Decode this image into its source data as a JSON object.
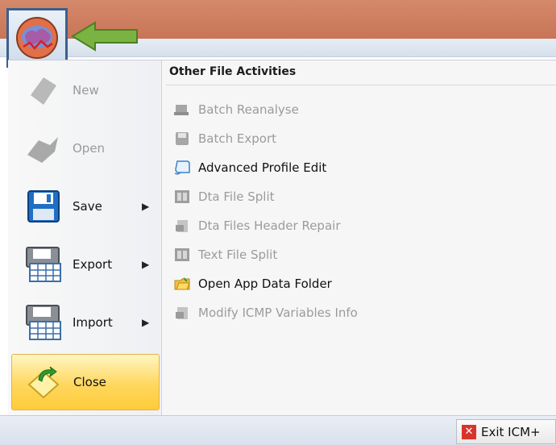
{
  "app_menu": {
    "items": [
      {
        "label": "New",
        "enabled": false,
        "has_submenu": false
      },
      {
        "label": "Open",
        "enabled": false,
        "has_submenu": false
      },
      {
        "label": "Save",
        "enabled": true,
        "has_submenu": true
      },
      {
        "label": "Export",
        "enabled": true,
        "has_submenu": true
      },
      {
        "label": "Import",
        "enabled": true,
        "has_submenu": true
      },
      {
        "label": "Close",
        "enabled": true,
        "has_submenu": false,
        "highlighted": true
      }
    ],
    "submenu_arrow": "▶"
  },
  "other_activities": {
    "title": "Other File Activities",
    "items": [
      {
        "label": "Batch Reanalyse",
        "enabled": false,
        "icon": "batch-reanalyse-icon"
      },
      {
        "label": "Batch Export",
        "enabled": false,
        "icon": "batch-export-icon"
      },
      {
        "label": "Advanced Profile Edit",
        "enabled": true,
        "icon": "profile-edit-icon"
      },
      {
        "label": "Dta File Split",
        "enabled": false,
        "icon": "film-split-icon"
      },
      {
        "label": "Dta Files Header Repair",
        "enabled": false,
        "icon": "header-repair-icon"
      },
      {
        "label": "Text File Split",
        "enabled": false,
        "icon": "film-split-icon"
      },
      {
        "label": "Open App Data Folder",
        "enabled": true,
        "icon": "folder-icon"
      },
      {
        "label": "Modify ICMP Variables Info",
        "enabled": false,
        "icon": "modify-variables-icon"
      }
    ]
  },
  "status_bar": {
    "exit_label": "Exit ICM+"
  },
  "colors": {
    "title_bar": "#c87556",
    "app_button_border": "#3d5f8c",
    "arrow_green": "#7ab341",
    "close_highlight": "#ffd75e",
    "disabled_text": "#9b9b9b",
    "exit_red": "#d9342b"
  }
}
